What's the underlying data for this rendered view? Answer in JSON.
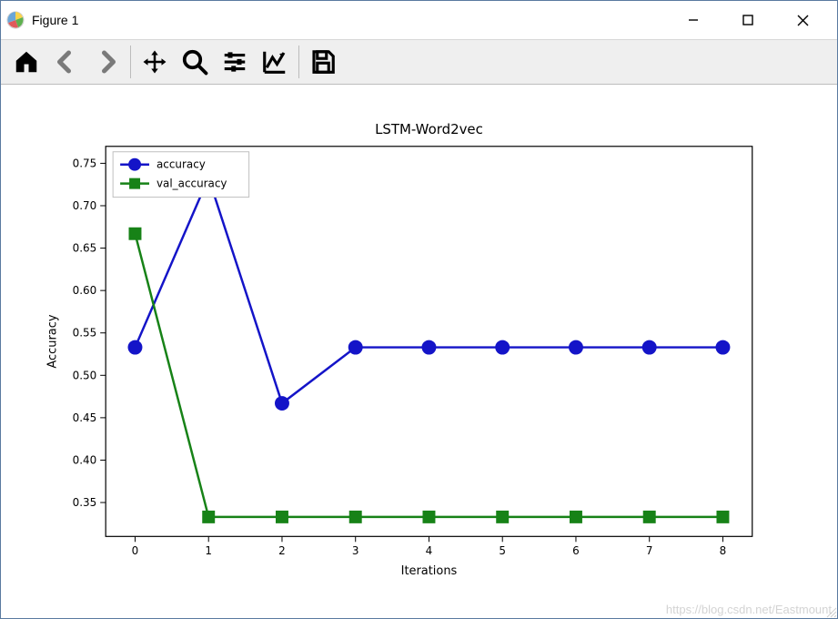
{
  "window": {
    "title": "Figure 1"
  },
  "toolbar": {
    "home": "home-icon",
    "back": "arrow-left-icon",
    "forward": "arrow-right-icon",
    "pan": "move-icon",
    "zoom": "zoom-icon",
    "subplots": "sliders-icon",
    "axes": "line-chart-icon",
    "save": "save-icon"
  },
  "watermark": "https://blog.csdn.net/Eastmount",
  "chart_data": {
    "type": "line",
    "title": "LSTM-Word2vec",
    "xlabel": "Iterations",
    "ylabel": "Accuracy",
    "x": [
      0,
      1,
      2,
      3,
      4,
      5,
      6,
      7,
      8
    ],
    "xlim": [
      -0.4,
      8.4
    ],
    "ylim": [
      0.31,
      0.77
    ],
    "yticks": [
      0.35,
      0.4,
      0.45,
      0.5,
      0.55,
      0.6,
      0.65,
      0.7,
      0.75
    ],
    "ytick_labels": [
      "0.35",
      "0.40",
      "0.45",
      "0.50",
      "0.55",
      "0.60",
      "0.65",
      "0.70",
      "0.75"
    ],
    "series": [
      {
        "name": "accuracy",
        "color": "#1414c8",
        "marker": "circle",
        "values": [
          0.533,
          0.733,
          0.467,
          0.533,
          0.533,
          0.533,
          0.533,
          0.533,
          0.533
        ]
      },
      {
        "name": "val_accuracy",
        "color": "#178217",
        "marker": "square",
        "values": [
          0.667,
          0.333,
          0.333,
          0.333,
          0.333,
          0.333,
          0.333,
          0.333,
          0.333
        ]
      }
    ],
    "legend": {
      "position": "upper left",
      "items": [
        "accuracy",
        "val_accuracy"
      ]
    }
  }
}
